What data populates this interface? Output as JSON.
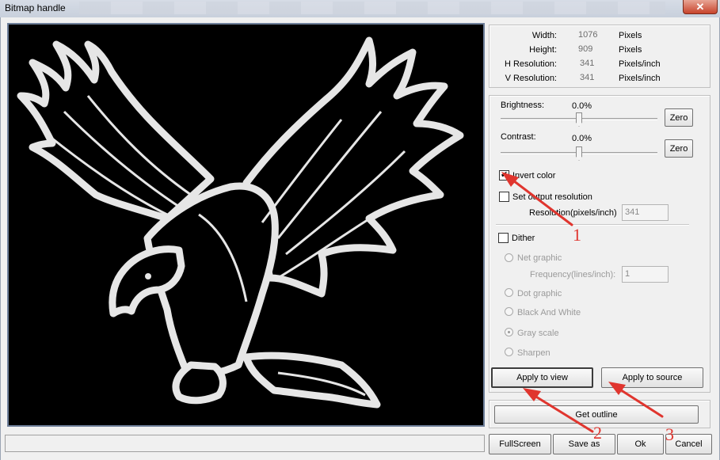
{
  "window": {
    "title": "Bitmap handle",
    "close_glyph": "✕"
  },
  "info": {
    "width_label": "Width:",
    "width_value": "1076",
    "width_unit": "Pixels",
    "height_label": "Height:",
    "height_value": "909",
    "height_unit": "Pixels",
    "hres_label": "H Resolution:",
    "hres_value": "341",
    "hres_unit": "Pixels/inch",
    "vres_label": "V Resolution:",
    "vres_value": "341",
    "vres_unit": "Pixels/inch"
  },
  "adjust": {
    "brightness_label": "Brightness:",
    "brightness_value": "0.0%",
    "brightness_level": 0.0,
    "contrast_label": "Contrast:",
    "contrast_value": "0.0%",
    "contrast_level": 0.0,
    "zero_label": "Zero",
    "invert_label": "Invert color",
    "invert_checked": true,
    "set_res_label": "Set output resolution",
    "set_res_checked": false,
    "resolution_label": "Resolution(pixels/inch)",
    "resolution_value": "341",
    "dither_label": "Dither",
    "dither_checked": false,
    "net_graphic_label": "Net graphic",
    "frequency_label": "Frequency(lines/inch):",
    "frequency_value": "1",
    "dot_graphic_label": "Dot graphic",
    "bw_label": "Black And White",
    "gray_label": "Gray scale",
    "gray_selected": true,
    "sharpen_label": "Sharpen"
  },
  "actions": {
    "apply_view": "Apply to view",
    "apply_source": "Apply to source",
    "get_outline": "Get outline",
    "fullscreen": "FullScreen",
    "save_as": "Save as",
    "ok": "Ok",
    "cancel": "Cancel"
  },
  "annotations": {
    "one": "1",
    "two": "2",
    "three": "3",
    "color": "#e0352e"
  }
}
